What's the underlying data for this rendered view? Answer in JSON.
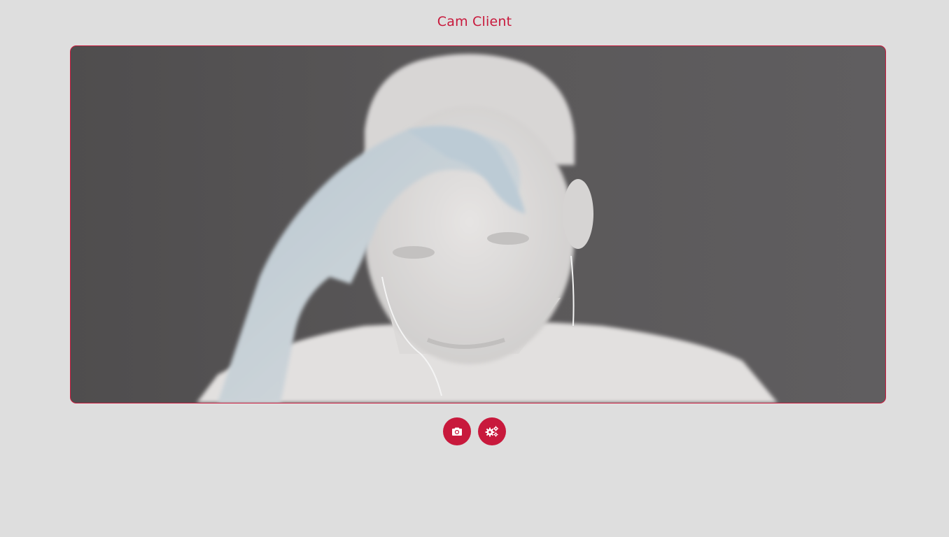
{
  "app": {
    "title": "Cam Client",
    "accent_color": "#c8193c",
    "background_color": "#dedede"
  },
  "video": {
    "icon": "camera-feed"
  },
  "controls": {
    "snapshot_icon": "camera-icon",
    "settings_icon": "gears-icon"
  }
}
